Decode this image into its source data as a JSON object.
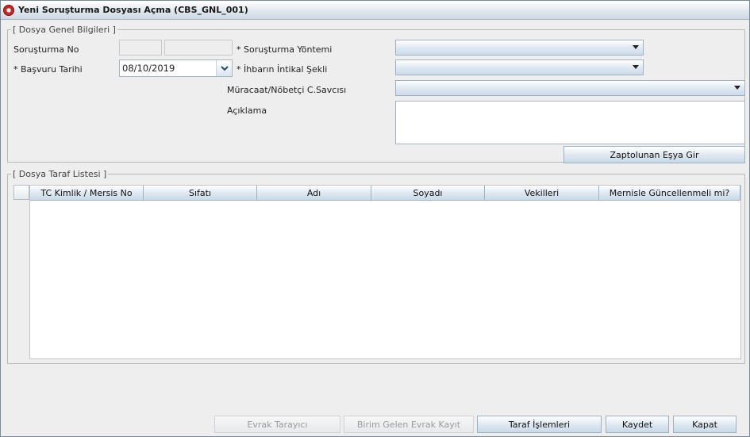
{
  "window": {
    "title": "Yeni Soruşturma Dosyası Açma (CBS_GNL_001)"
  },
  "general": {
    "legend": "[ Dosya Genel Bilgileri ]",
    "sorusturma_no_label": "Soruşturma No",
    "basvuru_tarihi_label": "* Başvuru Tarihi",
    "basvuru_tarihi_value": "08/10/2019",
    "sorusturma_yontemi_label": "* Soruşturma Yöntemi",
    "ihbar_intikal_label": "* İhbarın İntikal Şekli",
    "muracaat_label": "Müracaat/Nöbetçi C.Savcısı",
    "aciklama_label": "Açıklama",
    "zapt_button": "Zaptolunan Eşya Gir"
  },
  "parties": {
    "legend": "[ Dosya Taraf Listesi ]",
    "columns": [
      "TC Kimlik / Mersis No",
      "Sıfatı",
      "Adı",
      "Soyadı",
      "Vekilleri",
      "Mernisle Güncellenmeli mi?"
    ]
  },
  "footer": {
    "evrak_tarayici": "Evrak Tarayıcı",
    "birim_gelen_evrak": "Birim Gelen Evrak Kayıt",
    "taraf_islemleri": "Taraf İşlemleri",
    "kaydet": "Kaydet",
    "kapat": "Kapat"
  }
}
